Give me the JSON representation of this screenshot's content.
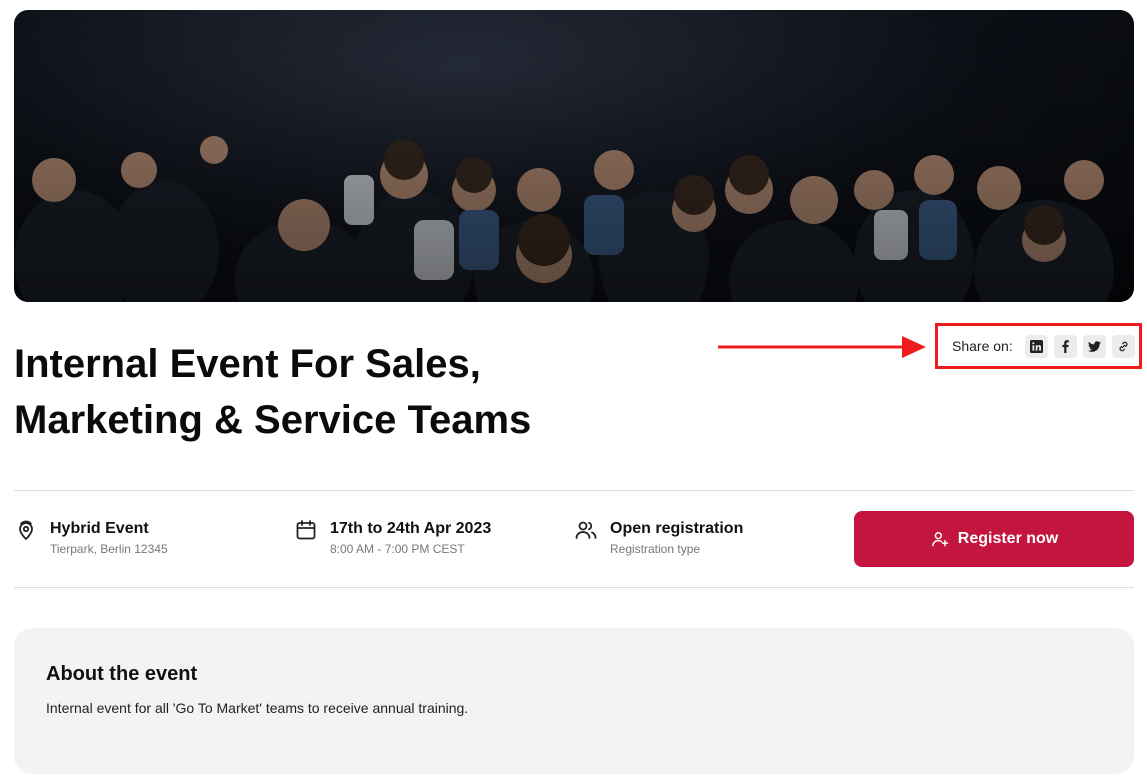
{
  "event": {
    "title": "Internal Event For Sales, Marketing & Service Teams"
  },
  "hero_image": {
    "alt": "audience seated at a conference"
  },
  "share": {
    "label": "Share on:",
    "buttons": [
      {
        "icon": "linkedin-icon"
      },
      {
        "icon": "facebook-icon"
      },
      {
        "icon": "twitter-icon"
      },
      {
        "icon": "link-icon"
      }
    ]
  },
  "details": {
    "location": {
      "title": "Hybrid Event",
      "subtitle": "Tierpark, Berlin 12345",
      "icon": "location-pin-icon"
    },
    "date": {
      "title": "17th to 24th Apr 2023",
      "subtitle": "8:00 AM - 7:00 PM CEST",
      "icon": "calendar-icon"
    },
    "registration": {
      "title": "Open registration",
      "subtitle": "Registration type",
      "icon": "users-icon"
    }
  },
  "register_button": {
    "label": "Register now",
    "icon": "add-user-icon"
  },
  "about": {
    "heading": "About the event",
    "description": "Internal event for all 'Go To Market' teams to receive annual training."
  },
  "colors": {
    "primary": "#c4153f",
    "annotation": "#ee1c1c",
    "about_bg": "#f3f3f3"
  }
}
